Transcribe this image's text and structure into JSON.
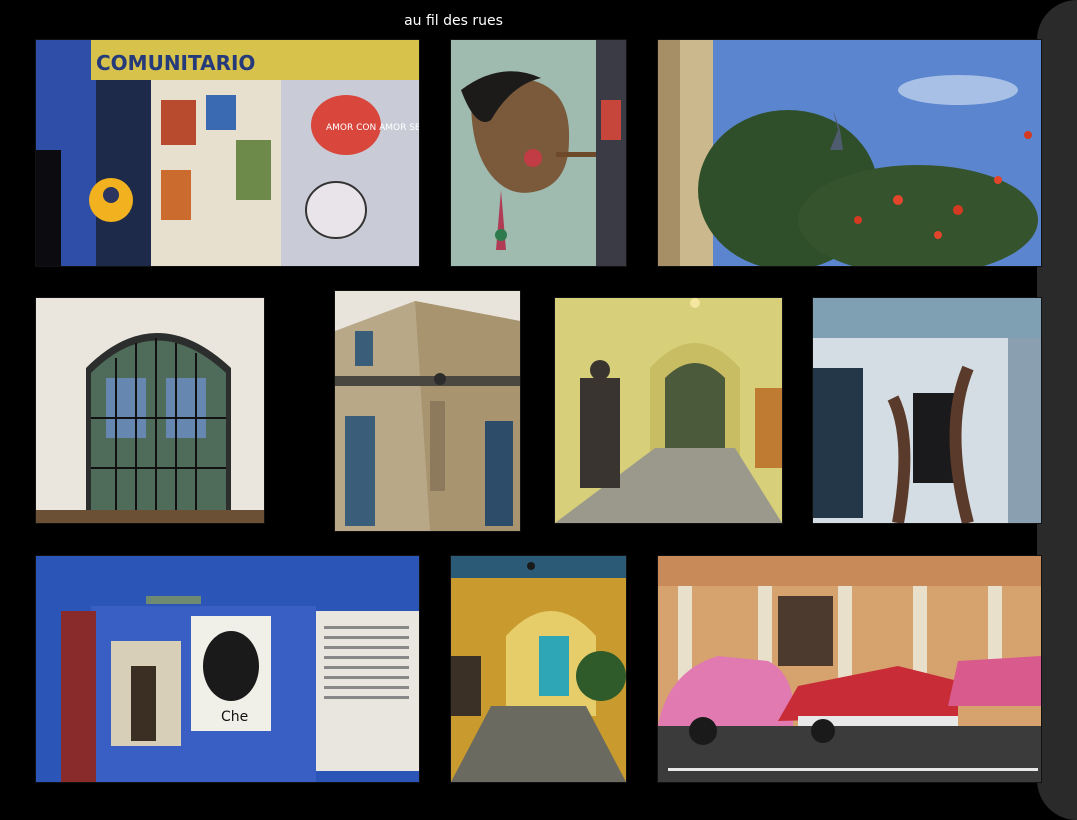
{
  "header": {
    "title": "au fil des rues"
  },
  "photos": [
    {
      "name": "photo-street-art-gallery",
      "sign_text": "COMUNITARIO",
      "mural_text": "AMOR CON AMOR SE PAGA"
    },
    {
      "name": "photo-mural-face-cigar"
    },
    {
      "name": "photo-sky-tree-statue"
    },
    {
      "name": "photo-arched-gate"
    },
    {
      "name": "photo-colonial-corner-building"
    },
    {
      "name": "photo-warrior-statue-corridor"
    },
    {
      "name": "photo-film-reel-facade"
    },
    {
      "name": "photo-che-portrait-room",
      "portrait_caption": "Che"
    },
    {
      "name": "photo-blue-door-archway"
    },
    {
      "name": "photo-pink-classic-cars"
    }
  ],
  "colors": {
    "background": "#000000",
    "frame": "#2a2a2a",
    "title_text": "#ffffff"
  }
}
